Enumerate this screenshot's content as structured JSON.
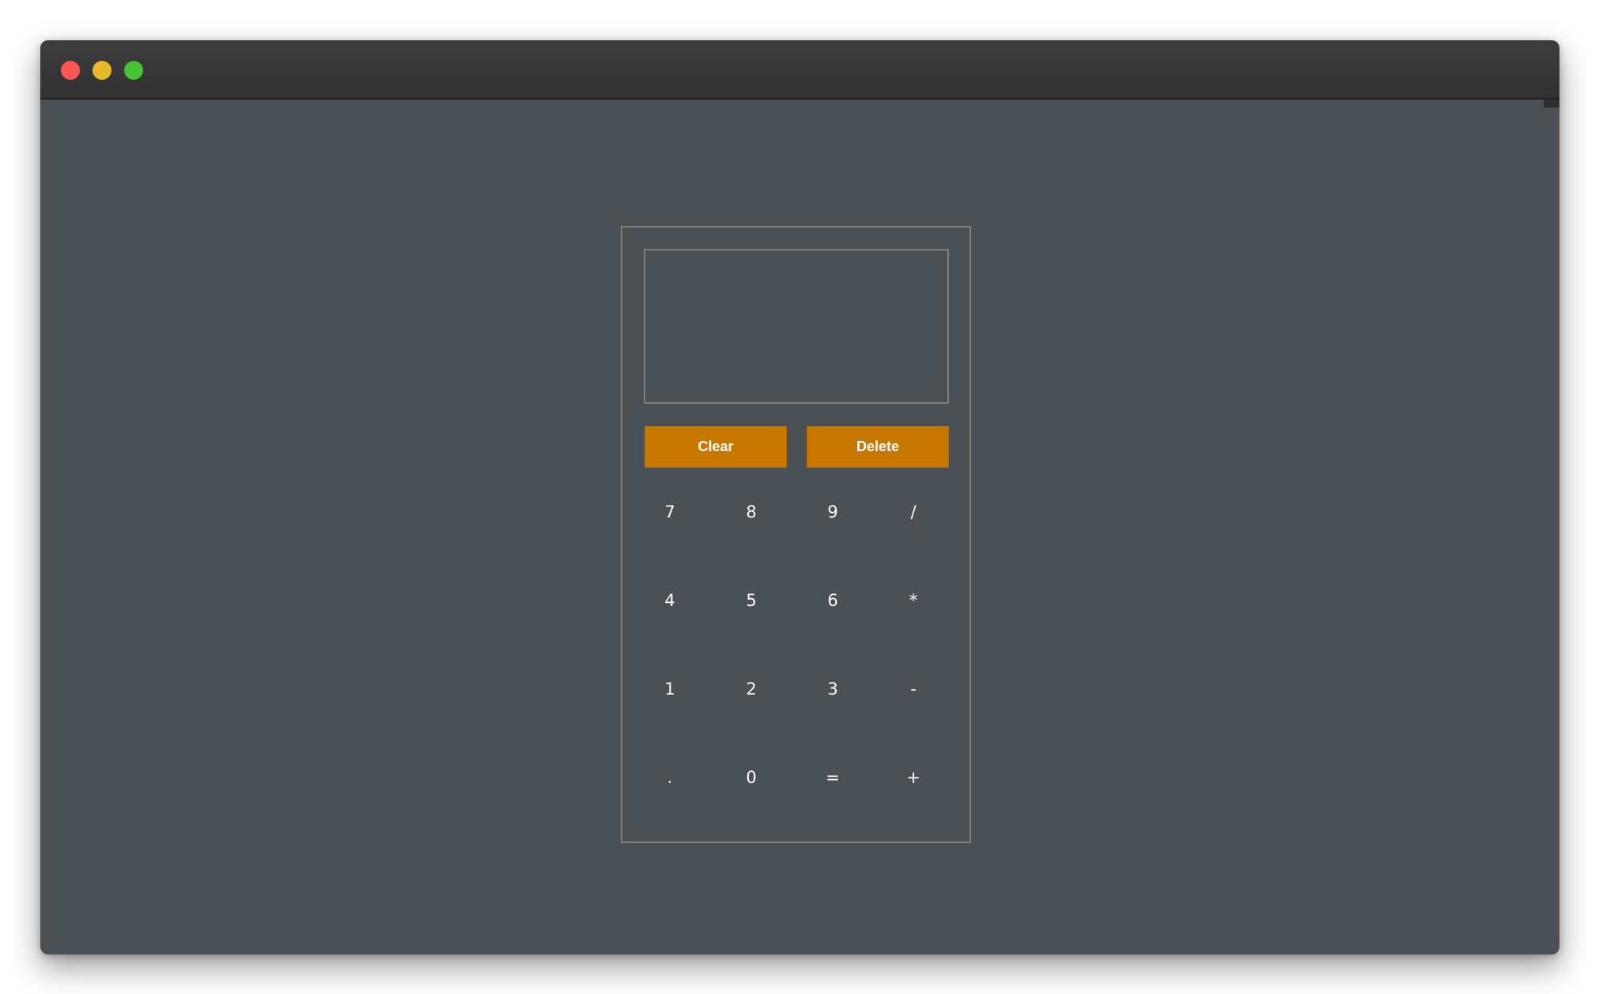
{
  "window": {
    "controls": {
      "close_color": "#fc5753",
      "minimize_color": "#e6bb29",
      "maximize_color": "#47c234"
    }
  },
  "calculator": {
    "display": {
      "value": ""
    },
    "actions": {
      "clear_label": "Clear",
      "delete_label": "Delete",
      "color": "#c87800"
    },
    "keys": [
      {
        "label": "7",
        "name": "key-7"
      },
      {
        "label": "8",
        "name": "key-8"
      },
      {
        "label": "9",
        "name": "key-9"
      },
      {
        "label": "/",
        "name": "key-divide"
      },
      {
        "label": "4",
        "name": "key-4"
      },
      {
        "label": "5",
        "name": "key-5"
      },
      {
        "label": "6",
        "name": "key-6"
      },
      {
        "label": "*",
        "name": "key-multiply"
      },
      {
        "label": "1",
        "name": "key-1"
      },
      {
        "label": "2",
        "name": "key-2"
      },
      {
        "label": "3",
        "name": "key-3"
      },
      {
        "label": "-",
        "name": "key-subtract"
      },
      {
        "label": ".",
        "name": "key-decimal"
      },
      {
        "label": "0",
        "name": "key-0"
      },
      {
        "label": "=",
        "name": "key-equals"
      },
      {
        "label": "+",
        "name": "key-add"
      }
    ]
  }
}
